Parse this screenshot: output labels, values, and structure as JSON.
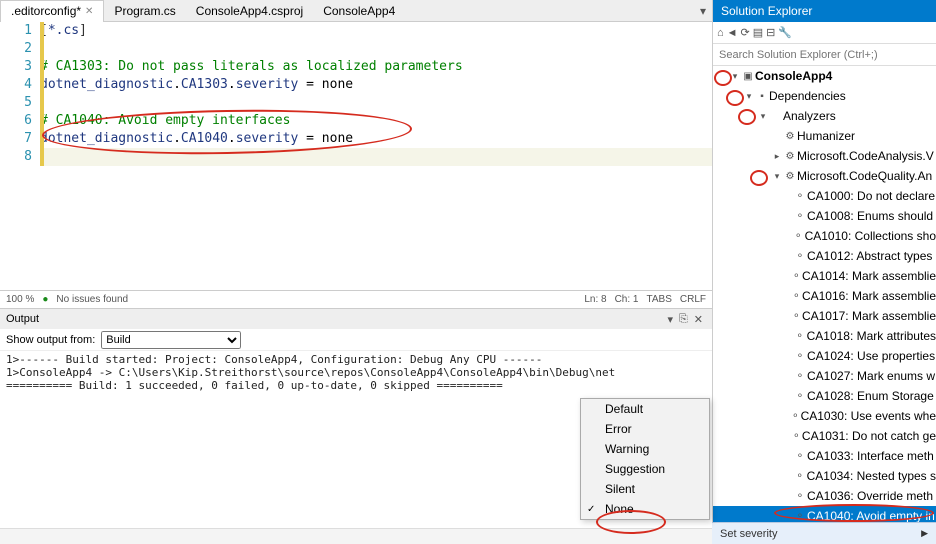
{
  "tabs": [
    {
      "label": ".editorconfig*",
      "active": true
    },
    {
      "label": "Program.cs",
      "active": false
    },
    {
      "label": "ConsoleApp4.csproj",
      "active": false
    },
    {
      "label": "ConsoleApp4",
      "active": false
    }
  ],
  "editor": {
    "lines": [
      {
        "n": 1,
        "html": "<span class='tok-p'>[</span><span class='tok-s'>*.cs</span><span class='tok-p'>]</span>"
      },
      {
        "n": 2,
        "html": ""
      },
      {
        "n": 3,
        "html": "<span class='tok-g'># CA1303: Do not pass literals as localized parameters</span>"
      },
      {
        "n": 4,
        "html": "<span class='tok-n'>dotnet_diagnostic</span>.<span class='tok-n'>CA1303</span>.<span class='tok-n'>severity</span> = none"
      },
      {
        "n": 5,
        "html": ""
      },
      {
        "n": 6,
        "html": "<span class='tok-g'># CA1040: Avoid empty interfaces</span>"
      },
      {
        "n": 7,
        "html": "<span class='tok-n'>dotnet_diagnostic</span>.<span class='tok-n'>CA1040</span>.<span class='tok-n'>severity</span> = none"
      },
      {
        "n": 8,
        "html": ""
      }
    ],
    "current_line": 8
  },
  "status": {
    "zoom": "100 %",
    "issues": "No issues found",
    "ln": "Ln: 8",
    "ch": "Ch: 1",
    "tabs": "TABS",
    "crlf": "CRLF"
  },
  "output": {
    "title": "Output",
    "show_from_label": "Show output from:",
    "source": "Build",
    "text": "1>------ Build started: Project: ConsoleApp4, Configuration: Debug Any CPU ------\n1>ConsoleApp4 -> C:\\Users\\Kip.Streithorst\\source\\repos\\ConsoleApp4\\ConsoleApp4\\bin\\Debug\\net\n========== Build: 1 succeeded, 0 failed, 0 up-to-date, 0 skipped =========="
  },
  "solution": {
    "title": "Solution Explorer",
    "search_placeholder": "Search Solution Explorer (Ctrl+;)",
    "tree": [
      {
        "ind": 1,
        "exp": "▾",
        "icon": "▣",
        "label": "ConsoleApp4",
        "bold": true
      },
      {
        "ind": 2,
        "exp": "▾",
        "icon": "▪",
        "label": "Dependencies"
      },
      {
        "ind": 3,
        "exp": "▾",
        "icon": "",
        "label": "Analyzers"
      },
      {
        "ind": 4,
        "exp": "",
        "icon": "⚙",
        "label": "Humanizer"
      },
      {
        "ind": 4,
        "exp": "▸",
        "icon": "⚙",
        "label": "Microsoft.CodeAnalysis.V"
      },
      {
        "ind": 4,
        "exp": "▾",
        "icon": "⚙",
        "label": "Microsoft.CodeQuality.An"
      },
      {
        "ind": 5,
        "exp": "",
        "icon": "⚬",
        "label": "CA1000: Do not declare"
      },
      {
        "ind": 5,
        "exp": "",
        "icon": "⚬",
        "label": "CA1008: Enums should"
      },
      {
        "ind": 5,
        "exp": "",
        "icon": "⚬",
        "label": "CA1010: Collections sho"
      },
      {
        "ind": 5,
        "exp": "",
        "icon": "⚬",
        "label": "CA1012: Abstract types"
      },
      {
        "ind": 5,
        "exp": "",
        "icon": "⚬",
        "label": "CA1014: Mark assemblie"
      },
      {
        "ind": 5,
        "exp": "",
        "icon": "⚬",
        "label": "CA1016: Mark assemblie"
      },
      {
        "ind": 5,
        "exp": "",
        "icon": "⚬",
        "label": "CA1017: Mark assemblie"
      },
      {
        "ind": 5,
        "exp": "",
        "icon": "⚬",
        "label": "CA1018: Mark attributes"
      },
      {
        "ind": 5,
        "exp": "",
        "icon": "⚬",
        "label": "CA1024: Use properties"
      },
      {
        "ind": 5,
        "exp": "",
        "icon": "⚬",
        "label": "CA1027: Mark enums w"
      },
      {
        "ind": 5,
        "exp": "",
        "icon": "⚬",
        "label": "CA1028: Enum Storage"
      },
      {
        "ind": 5,
        "exp": "",
        "icon": "⚬",
        "label": "CA1030: Use events whe"
      },
      {
        "ind": 5,
        "exp": "",
        "icon": "⚬",
        "label": "CA1031: Do not catch ge"
      },
      {
        "ind": 5,
        "exp": "",
        "icon": "⚬",
        "label": "CA1033: Interface meth"
      },
      {
        "ind": 5,
        "exp": "",
        "icon": "⚬",
        "label": "CA1034: Nested types s"
      },
      {
        "ind": 5,
        "exp": "",
        "icon": "⚬",
        "label": "CA1036: Override meth"
      },
      {
        "ind": 5,
        "exp": "",
        "icon": "⚬",
        "label": "CA1040: Avoid empty in",
        "selected": true
      }
    ]
  },
  "severity_menu": {
    "label": "Set severity",
    "items": [
      "Default",
      "Error",
      "Warning",
      "Suggestion",
      "Silent",
      "None"
    ],
    "checked": "None"
  }
}
